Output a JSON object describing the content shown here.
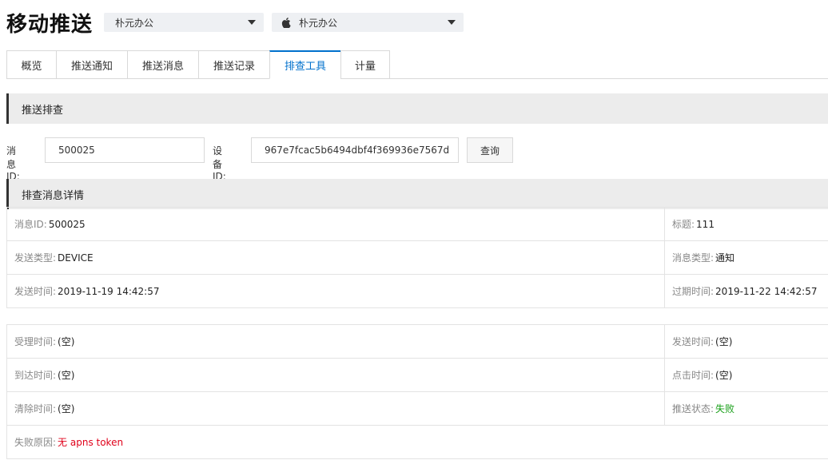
{
  "header": {
    "title": "移动推送",
    "app_select": "朴元办公",
    "platform_select": "朴元办公"
  },
  "tabs": [
    {
      "label": "概览",
      "active": false
    },
    {
      "label": "推送通知",
      "active": false
    },
    {
      "label": "推送消息",
      "active": false
    },
    {
      "label": "推送记录",
      "active": false
    },
    {
      "label": "排查工具",
      "active": true
    },
    {
      "label": "计量",
      "active": false
    }
  ],
  "query": {
    "section_title": "推送排查",
    "message_id_label": "消息ID:",
    "message_id_value": "500025",
    "device_id_label": "设备ID:",
    "device_id_value": "967e7fcac5b6494dbf4f369936e7567d",
    "search_button": "查询"
  },
  "details": {
    "section_title": "排查消息详情",
    "rows1": [
      {
        "lk": "消息ID:",
        "lv": "500025",
        "rk": "标题:",
        "rv": "111"
      },
      {
        "lk": "发送类型:",
        "lv": "DEVICE",
        "rk": "消息类型:",
        "rv": "通知"
      },
      {
        "lk": "发送时间:",
        "lv": "2019-11-19 14:42:57",
        "rk": "过期时间:",
        "rv": "2019-11-22 14:42:57"
      }
    ],
    "rows2": [
      {
        "lk": "受理时间:",
        "lv": "(空)",
        "rk": "发送时间:",
        "rv": "(空)"
      },
      {
        "lk": "到达时间:",
        "lv": "(空)",
        "rk": "点击时间:",
        "rv": "(空)"
      },
      {
        "lk": "清除时间:",
        "lv": "(空)",
        "rk": "推送状态:",
        "rv": "失败"
      }
    ],
    "fail_reason_label": "失败原因:",
    "fail_reason_value": "无 apns token"
  },
  "colors": {
    "accent": "#0070cc",
    "status_fail": "#1aa01a",
    "error": "#e0001a"
  }
}
